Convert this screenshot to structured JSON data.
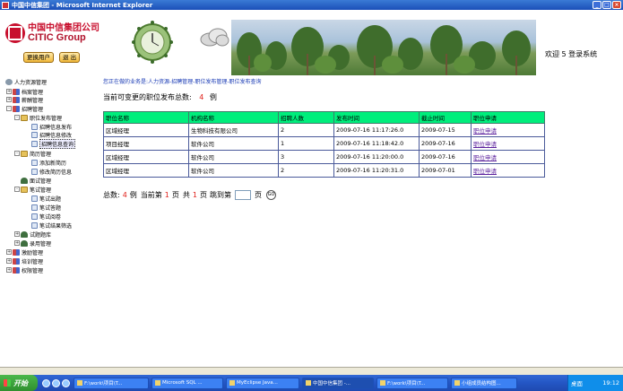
{
  "window": {
    "title": "中国中信集团 - Microsoft Internet Explorer"
  },
  "header": {
    "logo_cn": "中国中信集团公司",
    "logo_en": "CITIC Group",
    "switch_user_label": "更换用户",
    "logout_label": "退 出",
    "welcome": "欢迎 5 登录系统"
  },
  "sidebar": {
    "root": "人力资源管理",
    "items": [
      "档案管理",
      "薪酬管理",
      "招聘管理",
      "职位发布管理",
      "招聘信息发布",
      "招聘信息修改",
      "招聘信息查询",
      "简历管理",
      "添加新简历",
      "修改简历信息",
      "面试管理",
      "笔试管理",
      "笔试出题",
      "笔试答题",
      "笔试阅卷",
      "笔试结果筛选",
      "试题题库",
      "录用管理",
      "激励管理",
      "培训管理",
      "权限管理"
    ]
  },
  "main": {
    "breadcrumb": "您正在做的业务是:人力资源-招聘管理-职位发布管理-职位发布查询",
    "summary_label": "当前可变更的职位发布总数:",
    "summary_count": "4",
    "summary_unit": "例",
    "table": {
      "headers": [
        "职位名称",
        "机构名称",
        "招聘人数",
        "发布时间",
        "截止时间",
        "职位申请"
      ],
      "rows": [
        [
          "区域经理",
          "生物科技有限公司",
          "2",
          "2009-07-16 11:17:26.0",
          "2009-07-15",
          "职位申请"
        ],
        [
          "项目经理",
          "软件公司",
          "1",
          "2009-07-16 11:18:42.0",
          "2009-07-16",
          "职位申请"
        ],
        [
          "区域经理",
          "软件公司",
          "3",
          "2009-07-16 11:20:00.0",
          "2009-07-16",
          "职位申请"
        ],
        [
          "区域经理",
          "软件公司",
          "2",
          "2009-07-16 11:20:31.0",
          "2009-07-01",
          "职位申请"
        ]
      ]
    },
    "pager": {
      "total_label": "总数:",
      "total": "4",
      "unit": "例",
      "current_label": "当前第",
      "current": "1",
      "page_unit": "页",
      "all_label": "共",
      "all": "1",
      "page_unit2": "页",
      "jump_label": "跳到第",
      "jump_unit": "页",
      "go_label": "GO"
    }
  },
  "taskbar": {
    "start_label": "开始",
    "tasks": [
      "F:\\work\\项目\\T...",
      "Microsoft SQL ...",
      "MyEclipse Java...",
      "中国中信集团 -...",
      "F:\\work\\项目\\T...",
      "小组成员结构图..."
    ],
    "desktop_label": "桌面",
    "clock": "19:12"
  }
}
